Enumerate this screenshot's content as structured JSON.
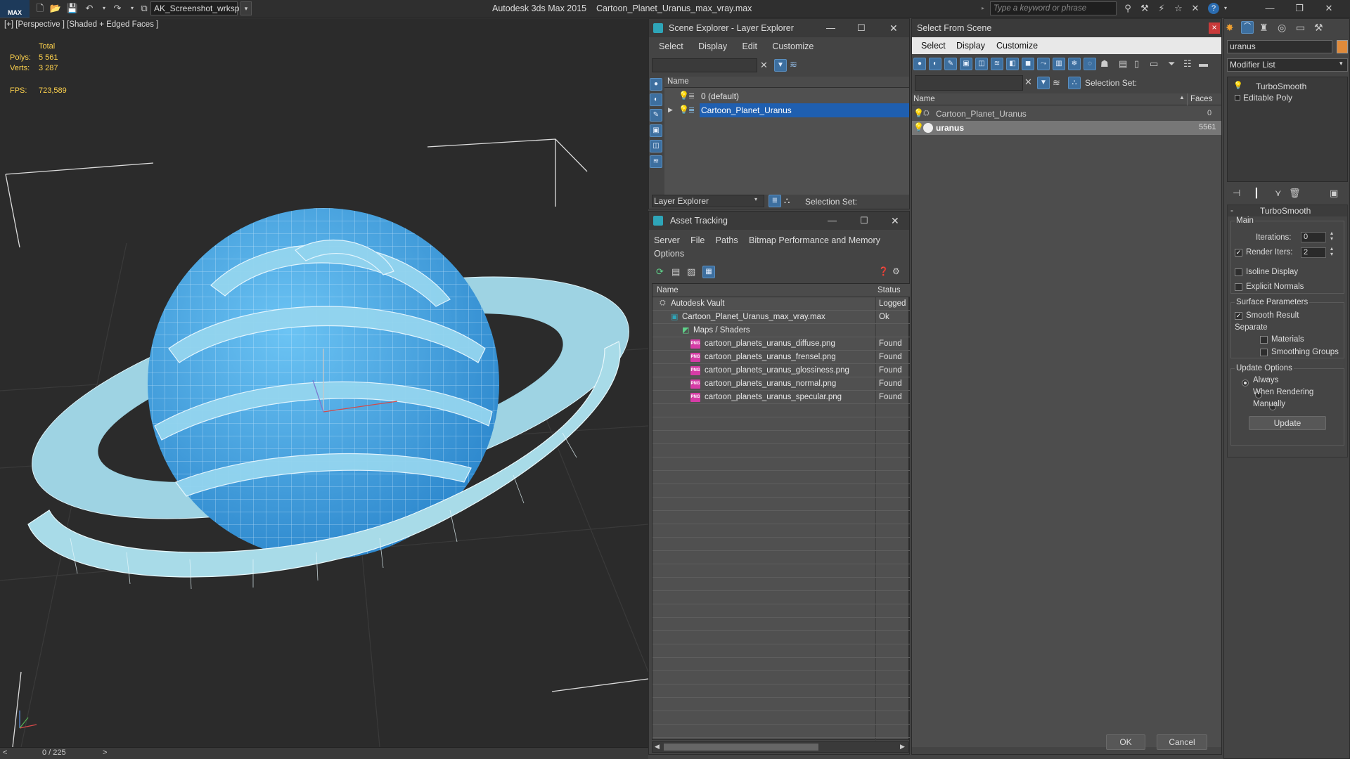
{
  "title_bar": {
    "app_badge": "MAX",
    "workspace": "AK_Screenshot_wrksp",
    "app_name": "Autodesk 3ds Max  2015",
    "file_name": "Cartoon_Planet_Uranus_max_vray.max",
    "search_placeholder": "Type a keyword or phrase"
  },
  "viewport": {
    "label": "[+] [Perspective ] [Shaded + Edged Faces ]",
    "stats": {
      "total_label": "Total",
      "polys_label": "Polys:",
      "polys_value": "5 561",
      "verts_label": "Verts:",
      "verts_value": "3 287",
      "fps_label": "FPS:",
      "fps_value": "723,589"
    },
    "timeline": {
      "prev": "<",
      "position": "0 / 225",
      "next": ">"
    }
  },
  "scene_explorer": {
    "title": "Scene Explorer - Layer Explorer",
    "menu": [
      "Select",
      "Display",
      "Edit",
      "Customize"
    ],
    "column_name": "Name",
    "rows": [
      {
        "label": "0 (default)",
        "selected": false
      },
      {
        "label": "Cartoon_Planet_Uranus",
        "selected": true
      }
    ],
    "footer_dropdown": "Layer Explorer",
    "selection_set_label": "Selection Set:"
  },
  "asset_tracking": {
    "title": "Asset Tracking",
    "menu": [
      "Server",
      "File",
      "Paths",
      "Bitmap Performance and Memory"
    ],
    "menu_row2": [
      "Options"
    ],
    "col_name": "Name",
    "col_status": "Status",
    "rows": [
      {
        "name": "Autodesk Vault",
        "status": "Logged",
        "indent": 0,
        "kind": "vault"
      },
      {
        "name": "Cartoon_Planet_Uranus_max_vray.max",
        "status": "Ok",
        "indent": 1,
        "kind": "max"
      },
      {
        "name": "Maps / Shaders",
        "status": "",
        "indent": 2,
        "kind": "maps"
      },
      {
        "name": "cartoon_planets_uranus_diffuse.png",
        "status": "Found",
        "indent": 3,
        "kind": "png"
      },
      {
        "name": "cartoon_planets_uranus_frensel.png",
        "status": "Found",
        "indent": 3,
        "kind": "png"
      },
      {
        "name": "cartoon_planets_uranus_glossiness.png",
        "status": "Found",
        "indent": 3,
        "kind": "png"
      },
      {
        "name": "cartoon_planets_uranus_normal.png",
        "status": "Found",
        "indent": 3,
        "kind": "png"
      },
      {
        "name": "cartoon_planets_uranus_specular.png",
        "status": "Found",
        "indent": 3,
        "kind": "png"
      }
    ],
    "png_badge": "PNG"
  },
  "select_from_scene": {
    "title": "Select From Scene",
    "close": "×",
    "menu": [
      "Select",
      "Display",
      "Customize"
    ],
    "selection_set_label": "Selection Set:",
    "col_name": "Name",
    "col_faces": "Faces",
    "rows": [
      {
        "name": "Cartoon_Planet_Uranus",
        "faces": "0",
        "selected": false
      },
      {
        "name": "uranus",
        "faces": "5561",
        "selected": true
      }
    ],
    "ok": "OK",
    "cancel": "Cancel"
  },
  "command_panel": {
    "object_name": "uranus",
    "modifier_list": "Modifier List",
    "stack": [
      "TurboSmooth",
      "Editable Poly"
    ],
    "rollout_title": "TurboSmooth",
    "collapse_sign": "-",
    "main_label": "Main",
    "iterations_label": "Iterations:",
    "iterations_value": "0",
    "render_iters_label": "Render Iters:",
    "render_iters_value": "2",
    "isoline_label": "Isoline Display",
    "explicit_normals_label": "Explicit Normals",
    "surface_params_label": "Surface Parameters",
    "smooth_result_label": "Smooth Result",
    "separate_label": "Separate",
    "materials_label": "Materials",
    "smoothing_groups_label": "Smoothing Groups",
    "update_options_label": "Update Options",
    "always_label": "Always",
    "when_rendering_label": "When Rendering",
    "manually_label": "Manually",
    "update_button": "Update"
  },
  "colors": {
    "accent": "#2f6fc4",
    "selection_row": "#1f5fb0",
    "planet": "#4aa6e8",
    "ring": "#a8dbe8",
    "stats_yellow": "#ffd34d"
  }
}
